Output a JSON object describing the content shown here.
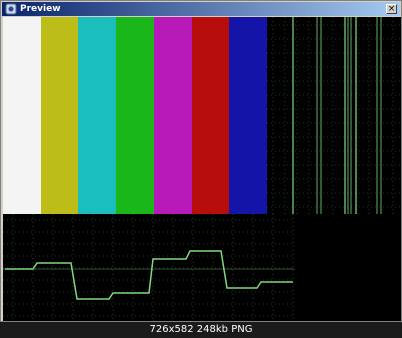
{
  "window": {
    "title": "Preview",
    "close_glyph": "×",
    "app_icon": "preview-app-icon"
  },
  "colors": {
    "titlebar_start": "#0a246a",
    "titlebar_end": "#a6caf0",
    "bars": [
      "#f4f4f4",
      "#bdbd1a",
      "#1abfbd",
      "#1ab71a",
      "#b71ab7",
      "#b80d0d",
      "#1414a8"
    ],
    "trace": "#7fd97f",
    "grid": "#3f6b3f"
  },
  "scope": {
    "vertical_traces": 9
  },
  "caption": "726x582 248kb PNG"
}
